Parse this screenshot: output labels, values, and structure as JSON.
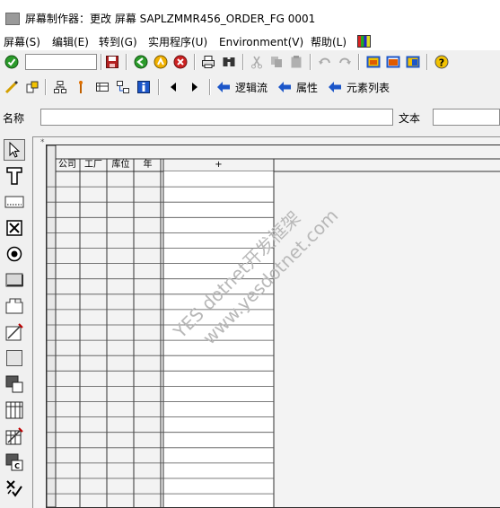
{
  "window": {
    "title": "屏幕制作器：更改 屏幕 SAPLZMMR456_ORDER_FG 0001"
  },
  "menu": [
    "屏幕(S)",
    "编辑(E)",
    "转到(G)",
    "实用程序(U)",
    "Environment(V)",
    "帮助(L)"
  ],
  "nav": {
    "logic_flow": "逻辑流",
    "attributes": "属性",
    "element_list": "元素列表"
  },
  "fields": {
    "name_label": "名称",
    "text_label": "文本",
    "name_value": "",
    "text_value": ""
  },
  "table": {
    "headers": [
      "公司",
      "工厂",
      "库位",
      "年"
    ],
    "input_header": "+"
  },
  "watermark": [
    "YES dotnet开发框架",
    "www.yesdotnet.com"
  ],
  "colors": {
    "accent_green": "#2b9b2b",
    "accent_red": "#cc2222",
    "nav_blue": "#1c56c9"
  }
}
